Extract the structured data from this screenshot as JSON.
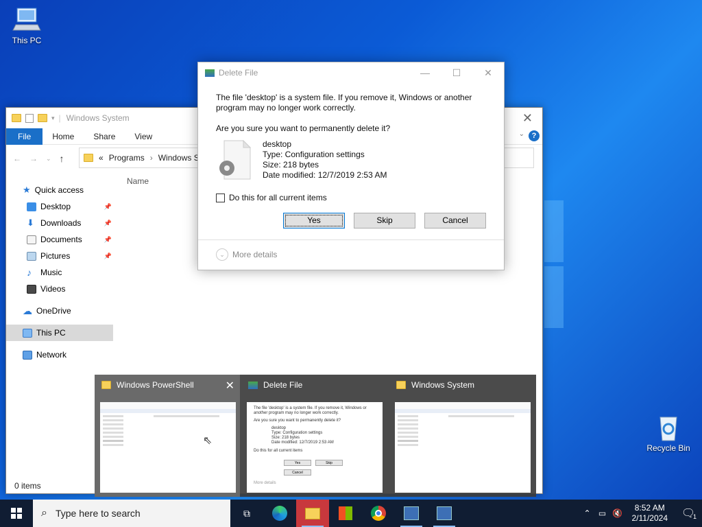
{
  "desktop": {
    "this_pc_label": "This PC",
    "recycle_bin_label": "Recycle Bin"
  },
  "explorer": {
    "title": "Windows System",
    "ribbon_tabs": [
      "File",
      "Home",
      "Share",
      "View"
    ],
    "help_label": "?",
    "address": {
      "chevron": "«",
      "crumbs": [
        "Programs",
        "Windows Sy"
      ]
    },
    "column_header": "Name",
    "nav": {
      "quick_access": "Quick access",
      "items": [
        "Desktop",
        "Downloads",
        "Documents",
        "Pictures",
        "Music",
        "Videos"
      ],
      "onedrive": "OneDrive",
      "this_pc": "This PC",
      "network": "Network"
    },
    "status": "0 items"
  },
  "dialog": {
    "title": "Delete File",
    "message": "The file 'desktop' is a system file. If you remove it, Windows or another program may no longer work correctly.",
    "question": "Are you sure you want to permanently delete it?",
    "file": {
      "name": "desktop",
      "type": "Type: Configuration settings",
      "size": "Size: 218 bytes",
      "modified": "Date modified: 12/7/2019 2:53 AM"
    },
    "checkbox_label": "Do this for all current items",
    "buttons": {
      "yes": "Yes",
      "skip": "Skip",
      "cancel": "Cancel"
    },
    "more_details": "More details"
  },
  "thumbnails": [
    {
      "title": "Windows PowerShell"
    },
    {
      "title": "Delete File"
    },
    {
      "title": "Windows System"
    }
  ],
  "taskbar": {
    "search_placeholder": "Type here to search",
    "time": "8:52 AM",
    "date": "2/11/2024",
    "notification_count": "1"
  },
  "colors": {
    "accent": "#1a6fc8",
    "taskbar": "#101d33",
    "active_app": "#c8383d"
  }
}
